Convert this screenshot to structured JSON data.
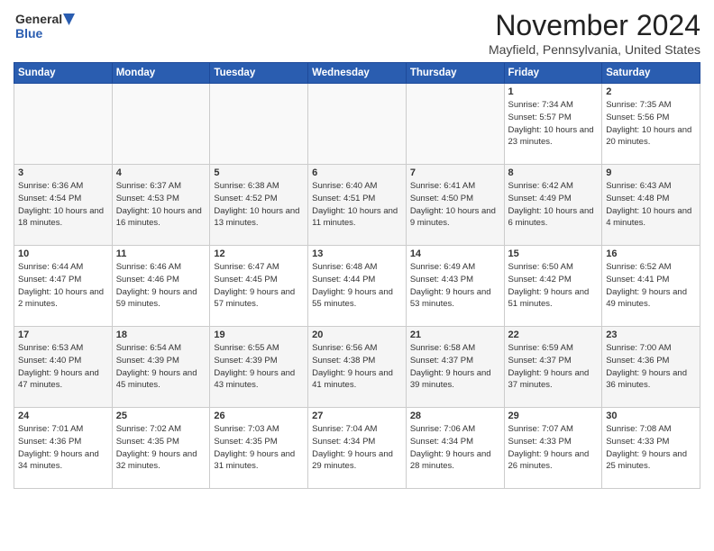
{
  "logo": {
    "line1": "General",
    "line2": "Blue"
  },
  "title": "November 2024",
  "location": "Mayfield, Pennsylvania, United States",
  "header_days": [
    "Sunday",
    "Monday",
    "Tuesday",
    "Wednesday",
    "Thursday",
    "Friday",
    "Saturday"
  ],
  "weeks": [
    [
      {
        "day": "",
        "content": ""
      },
      {
        "day": "",
        "content": ""
      },
      {
        "day": "",
        "content": ""
      },
      {
        "day": "",
        "content": ""
      },
      {
        "day": "",
        "content": ""
      },
      {
        "day": "1",
        "content": "Sunrise: 7:34 AM\nSunset: 5:57 PM\nDaylight: 10 hours and 23 minutes."
      },
      {
        "day": "2",
        "content": "Sunrise: 7:35 AM\nSunset: 5:56 PM\nDaylight: 10 hours and 20 minutes."
      }
    ],
    [
      {
        "day": "3",
        "content": "Sunrise: 6:36 AM\nSunset: 4:54 PM\nDaylight: 10 hours and 18 minutes."
      },
      {
        "day": "4",
        "content": "Sunrise: 6:37 AM\nSunset: 4:53 PM\nDaylight: 10 hours and 16 minutes."
      },
      {
        "day": "5",
        "content": "Sunrise: 6:38 AM\nSunset: 4:52 PM\nDaylight: 10 hours and 13 minutes."
      },
      {
        "day": "6",
        "content": "Sunrise: 6:40 AM\nSunset: 4:51 PM\nDaylight: 10 hours and 11 minutes."
      },
      {
        "day": "7",
        "content": "Sunrise: 6:41 AM\nSunset: 4:50 PM\nDaylight: 10 hours and 9 minutes."
      },
      {
        "day": "8",
        "content": "Sunrise: 6:42 AM\nSunset: 4:49 PM\nDaylight: 10 hours and 6 minutes."
      },
      {
        "day": "9",
        "content": "Sunrise: 6:43 AM\nSunset: 4:48 PM\nDaylight: 10 hours and 4 minutes."
      }
    ],
    [
      {
        "day": "10",
        "content": "Sunrise: 6:44 AM\nSunset: 4:47 PM\nDaylight: 10 hours and 2 minutes."
      },
      {
        "day": "11",
        "content": "Sunrise: 6:46 AM\nSunset: 4:46 PM\nDaylight: 9 hours and 59 minutes."
      },
      {
        "day": "12",
        "content": "Sunrise: 6:47 AM\nSunset: 4:45 PM\nDaylight: 9 hours and 57 minutes."
      },
      {
        "day": "13",
        "content": "Sunrise: 6:48 AM\nSunset: 4:44 PM\nDaylight: 9 hours and 55 minutes."
      },
      {
        "day": "14",
        "content": "Sunrise: 6:49 AM\nSunset: 4:43 PM\nDaylight: 9 hours and 53 minutes."
      },
      {
        "day": "15",
        "content": "Sunrise: 6:50 AM\nSunset: 4:42 PM\nDaylight: 9 hours and 51 minutes."
      },
      {
        "day": "16",
        "content": "Sunrise: 6:52 AM\nSunset: 4:41 PM\nDaylight: 9 hours and 49 minutes."
      }
    ],
    [
      {
        "day": "17",
        "content": "Sunrise: 6:53 AM\nSunset: 4:40 PM\nDaylight: 9 hours and 47 minutes."
      },
      {
        "day": "18",
        "content": "Sunrise: 6:54 AM\nSunset: 4:39 PM\nDaylight: 9 hours and 45 minutes."
      },
      {
        "day": "19",
        "content": "Sunrise: 6:55 AM\nSunset: 4:39 PM\nDaylight: 9 hours and 43 minutes."
      },
      {
        "day": "20",
        "content": "Sunrise: 6:56 AM\nSunset: 4:38 PM\nDaylight: 9 hours and 41 minutes."
      },
      {
        "day": "21",
        "content": "Sunrise: 6:58 AM\nSunset: 4:37 PM\nDaylight: 9 hours and 39 minutes."
      },
      {
        "day": "22",
        "content": "Sunrise: 6:59 AM\nSunset: 4:37 PM\nDaylight: 9 hours and 37 minutes."
      },
      {
        "day": "23",
        "content": "Sunrise: 7:00 AM\nSunset: 4:36 PM\nDaylight: 9 hours and 36 minutes."
      }
    ],
    [
      {
        "day": "24",
        "content": "Sunrise: 7:01 AM\nSunset: 4:36 PM\nDaylight: 9 hours and 34 minutes."
      },
      {
        "day": "25",
        "content": "Sunrise: 7:02 AM\nSunset: 4:35 PM\nDaylight: 9 hours and 32 minutes."
      },
      {
        "day": "26",
        "content": "Sunrise: 7:03 AM\nSunset: 4:35 PM\nDaylight: 9 hours and 31 minutes."
      },
      {
        "day": "27",
        "content": "Sunrise: 7:04 AM\nSunset: 4:34 PM\nDaylight: 9 hours and 29 minutes."
      },
      {
        "day": "28",
        "content": "Sunrise: 7:06 AM\nSunset: 4:34 PM\nDaylight: 9 hours and 28 minutes."
      },
      {
        "day": "29",
        "content": "Sunrise: 7:07 AM\nSunset: 4:33 PM\nDaylight: 9 hours and 26 minutes."
      },
      {
        "day": "30",
        "content": "Sunrise: 7:08 AM\nSunset: 4:33 PM\nDaylight: 9 hours and 25 minutes."
      }
    ]
  ]
}
